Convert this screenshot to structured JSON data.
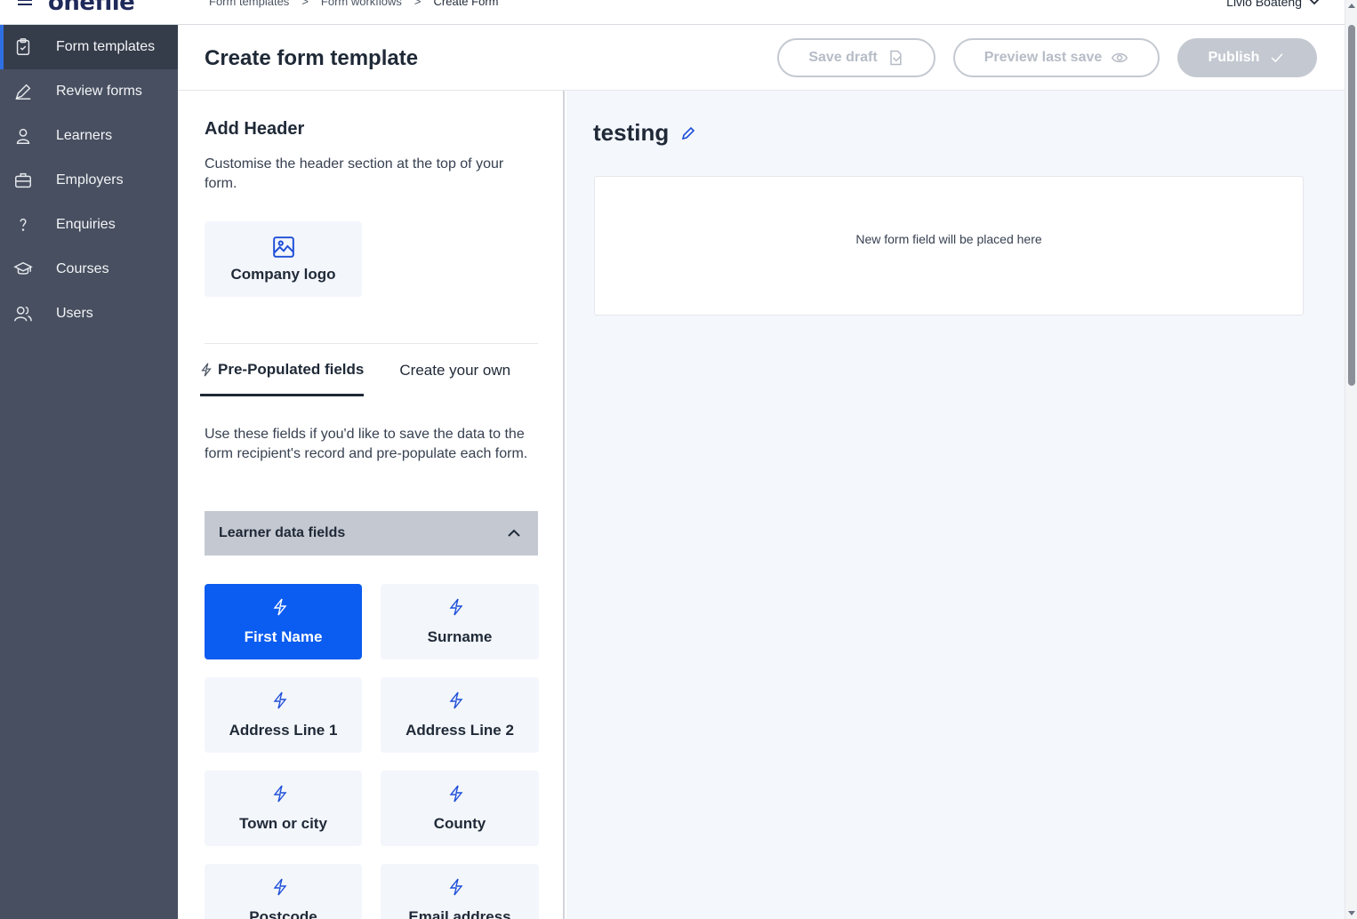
{
  "topbar": {
    "logo_text": "onefile",
    "breadcrumb": [
      "Form templates",
      "Form workflows",
      "Create Form"
    ],
    "user_name": "Livio Boateng"
  },
  "sidebar": {
    "items": [
      {
        "label": "Form templates",
        "icon": "clipboard-icon",
        "active": true
      },
      {
        "label": "Review forms",
        "icon": "pen-icon"
      },
      {
        "label": "Learners",
        "icon": "person-icon"
      },
      {
        "label": "Employers",
        "icon": "briefcase-icon"
      },
      {
        "label": "Enquiries",
        "icon": "question-icon"
      },
      {
        "label": "Courses",
        "icon": "graduation-cap-icon"
      },
      {
        "label": "Users",
        "icon": "users-icon"
      }
    ]
  },
  "header": {
    "title": "Create form template",
    "save_draft": "Save draft",
    "preview": "Preview last save",
    "publish": "Publish"
  },
  "builder": {
    "header_title": "Add Header",
    "header_desc": "Customise the header section at the top of your form.",
    "company_logo": "Company logo",
    "tabs": [
      "Pre-Populated fields",
      "Create your own"
    ],
    "tab_desc": "Use these fields if you'd like to save the data to the form recipient's record and pre-populate each form.",
    "accordion_label": "Learner data fields",
    "fields": [
      "First Name",
      "Surname",
      "Address Line 1",
      "Address Line 2",
      "Town or city",
      "County",
      "Postcode",
      "Email address"
    ],
    "selected_field": "First Name"
  },
  "canvas": {
    "form_name": "testing",
    "dropzone_text": "New form field will be placed here"
  },
  "colors": {
    "sidebar_bg": "#474f60",
    "accent": "#0b5cf0",
    "canvas_bg": "#f4f7fc"
  }
}
